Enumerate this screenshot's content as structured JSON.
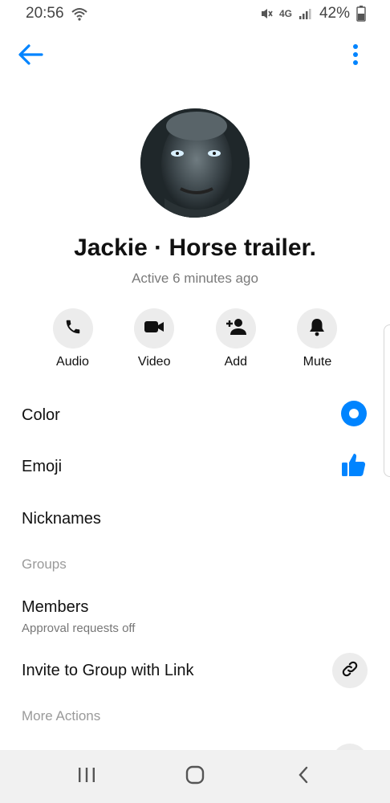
{
  "status": {
    "time": "20:56",
    "network": "4G",
    "battery": "42%"
  },
  "colors": {
    "accent": "#0084ff",
    "action_bg": "#ececec",
    "muted_text": "#7a7a7a"
  },
  "profile": {
    "name": "Jackie · Horse trailer.",
    "status": "Active 6 minutes ago"
  },
  "actions": [
    {
      "label": "Audio",
      "icon": "phone-icon"
    },
    {
      "label": "Video",
      "icon": "video-camera-icon"
    },
    {
      "label": "Add",
      "icon": "add-person-icon"
    },
    {
      "label": "Mute",
      "icon": "bell-icon"
    }
  ],
  "settings": {
    "color_label": "Color",
    "emoji_label": "Emoji",
    "nicknames_label": "Nicknames",
    "groups_header": "Groups",
    "members_label": "Members",
    "members_sub": "Approval requests off",
    "invite_label": "Invite to Group with Link",
    "more_actions_header": "More Actions"
  }
}
